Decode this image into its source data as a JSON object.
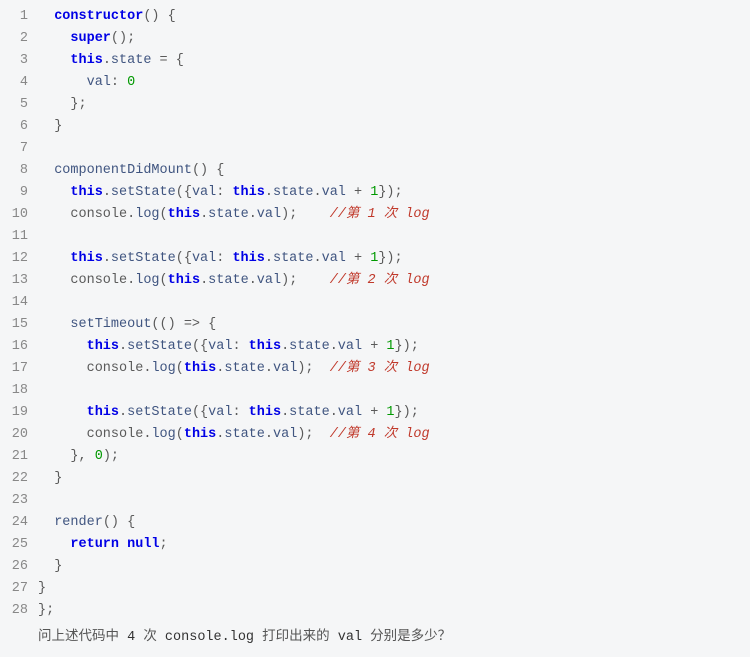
{
  "lineNumbers": [
    "1",
    "2",
    "3",
    "4",
    "5",
    "6",
    "7",
    "8",
    "9",
    "10",
    "11",
    "12",
    "13",
    "14",
    "15",
    "16",
    "17",
    "18",
    "19",
    "20",
    "21",
    "22",
    "23",
    "24",
    "25",
    "26",
    "27",
    "28"
  ],
  "code": {
    "l1_kw": "constructor",
    "l1_rest": "() {",
    "l2_kw": "super",
    "l2_rest": "();",
    "l3_kw": "this",
    "l3_dot": ".",
    "l3_state": "state",
    "l3_rest": " = {",
    "l4_prop": "val",
    "l4_colon": ": ",
    "l4_num": "0",
    "l5": "};",
    "l6": "}",
    "l8_fn": "componentDidMount",
    "l8_rest": "() {",
    "l9_this1": "this",
    "l9_dot1": ".",
    "l9_set": "setState",
    "l9_open": "({",
    "l9_val": "val",
    "l9_colon": ": ",
    "l9_this2": "this",
    "l9_dot2": ".",
    "l9_state": "state",
    "l9_dot3": ".",
    "l9_val2": "val",
    "l9_plus": " + ",
    "l9_num": "1",
    "l9_close": "});",
    "l10_console": "console",
    "l10_dot": ".",
    "l10_log": "log",
    "l10_open": "(",
    "l10_this": "this",
    "l10_dot2": ".",
    "l10_state": "state",
    "l10_dot3": ".",
    "l10_val": "val",
    "l10_close": ");",
    "l10_pad": "    ",
    "l10_comment": "//第 1 次 log",
    "l13_comment": "//第 2 次 log",
    "l15_fn": "setTimeout",
    "l15_rest": "(() => {",
    "l17_pad": "  ",
    "l17_comment": "//第 3 次 log",
    "l20_comment": "//第 4 次 log",
    "l21_close": "}, ",
    "l21_num": "0",
    "l21_end": ");",
    "l22": "}",
    "l24_fn": "render",
    "l24_rest": "() {",
    "l25_kw": "return",
    "l25_sp": " ",
    "l25_null": "null",
    "l25_semi": ";",
    "l26": "}",
    "l27": "}",
    "l28": "};"
  },
  "question": {
    "p1": "问上述代码中 ",
    "p2": "4",
    "p3": " 次 ",
    "p4": "console.log",
    "p5": " 打印出来的 ",
    "p6": "val",
    "p7": " 分别是多少？"
  }
}
